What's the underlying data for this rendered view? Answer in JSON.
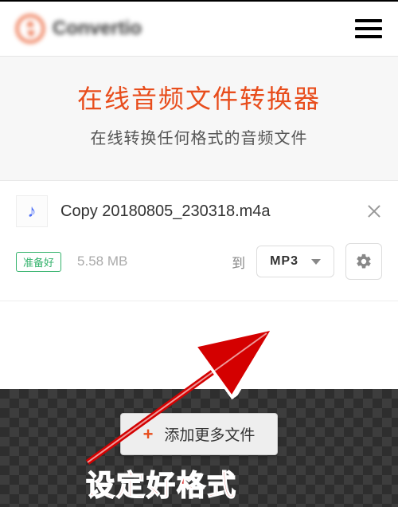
{
  "brand": {
    "name": "Convertio"
  },
  "hero": {
    "title": "在线音频文件转换器",
    "subtitle": "在线转换任何格式的音频文件"
  },
  "file": {
    "name": "Copy 20180805_230318.m4a",
    "status": "准备好",
    "size": "5.58 MB",
    "to_label": "到",
    "target_format": "MP3"
  },
  "actions": {
    "add_more": "添加更多文件"
  },
  "annotation": {
    "text": "设定好格式"
  }
}
